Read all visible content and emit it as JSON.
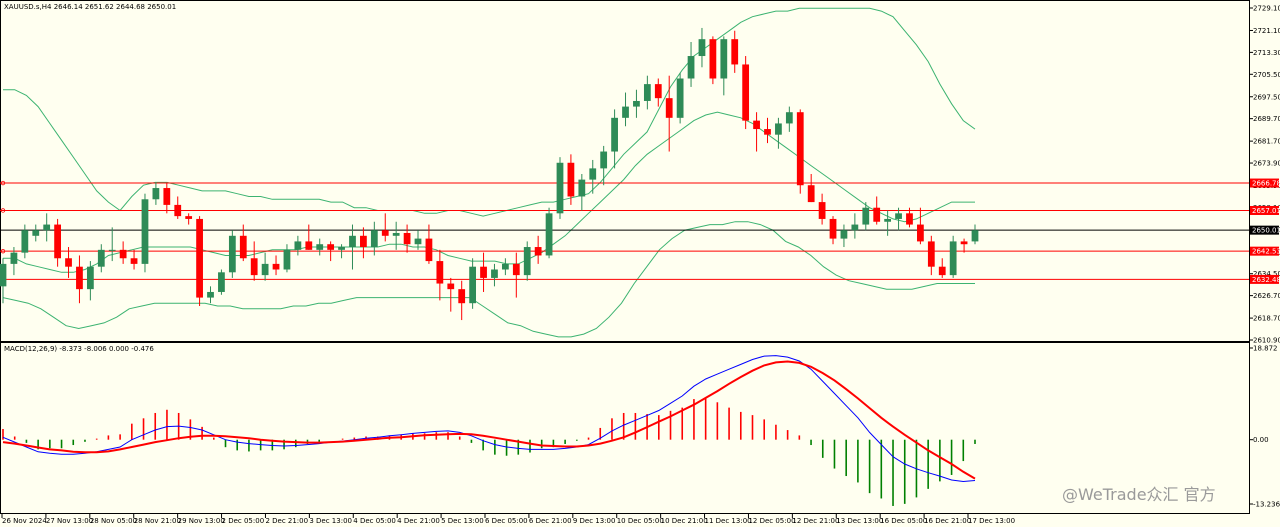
{
  "symbol_header": "XAUUSD.s,H4  2646.14 2651.62 2644.68 2650.01",
  "macd_header": "MACD(12,26,9) -8.373 -8.006 0.000 -0.476",
  "watermark": "@WeTrade众汇 官方",
  "colors": {
    "background": "#fffff0",
    "bull_candle": "#2e8b57",
    "bear_candle": "#ff0000",
    "bollinger": "#3cb371",
    "level_line": "#ff0000",
    "price_line": "#000000",
    "macd_line": "#0000ff",
    "signal_line": "#ff0000",
    "hist_pos": "#ff0000",
    "hist_neg": "#008000"
  },
  "chart_data": [
    {
      "type": "candlestick",
      "title": "XAUUSD.s,H4",
      "y_ticks": [
        "2729.10",
        "2721.10",
        "2713.30",
        "2705.50",
        "2697.50",
        "2689.70",
        "2681.70",
        "2673.90",
        "2665.90",
        "2658.10",
        "2650.30",
        "2642.30",
        "2634.50",
        "2626.70",
        "2618.70",
        "2610.90"
      ],
      "ylim": [
        2610.9,
        2729.1
      ],
      "x_labels": [
        "26 Nov 2024",
        "27 Nov 13:00",
        "28 Nov 05:00",
        "28 Nov 21:00",
        "29 Nov 13:00",
        "2 Dec 05:00",
        "2 Dec 21:00",
        "3 Dec 13:00",
        "4 Dec 05:00",
        "4 Dec 21:00",
        "5 Dec 13:00",
        "6 Dec 05:00",
        "6 Dec 21:00",
        "9 Dec 13:00",
        "10 Dec 05:00",
        "10 Dec 21:00",
        "11 Dec 13:00",
        "12 Dec 05:00",
        "12 Dec 21:00",
        "13 Dec 13:00",
        "16 Dec 05:00",
        "16 Dec 21:00",
        "17 Dec 13:00"
      ],
      "horizontal_levels": [
        {
          "label": "2666.78",
          "value": 2666.78
        },
        {
          "label": "2657.01",
          "value": 2657.01
        },
        {
          "label": "2642.53",
          "value": 2642.53
        },
        {
          "label": "2632.48",
          "value": 2632.48
        }
      ],
      "current_price": {
        "label": "2650.01",
        "value": 2650.01
      },
      "candles": [
        [
          2630,
          2640,
          2624,
          2638
        ],
        [
          2638,
          2644,
          2634,
          2642
        ],
        [
          2642,
          2652,
          2640,
          2650
        ],
        [
          2648,
          2652,
          2646,
          2650
        ],
        [
          2650,
          2656,
          2646,
          2652
        ],
        [
          2652,
          2654,
          2637,
          2640
        ],
        [
          2640,
          2644,
          2633,
          2637
        ],
        [
          2637,
          2641,
          2624,
          2629
        ],
        [
          2629,
          2639,
          2625,
          2637
        ],
        [
          2637,
          2645,
          2635,
          2643
        ],
        [
          2643,
          2651,
          2639,
          2643
        ],
        [
          2643,
          2646,
          2638,
          2640
        ],
        [
          2640,
          2643,
          2636,
          2638
        ],
        [
          2638,
          2663,
          2635,
          2661
        ],
        [
          2661,
          2667,
          2659,
          2665
        ],
        [
          2665,
          2667,
          2656,
          2659
        ],
        [
          2659,
          2662,
          2654,
          2655
        ],
        [
          2655,
          2656,
          2652,
          2654
        ],
        [
          2654,
          2655,
          2623,
          2626
        ],
        [
          2626,
          2630,
          2624,
          2628
        ],
        [
          2628,
          2636,
          2627,
          2635
        ],
        [
          2635,
          2650,
          2633,
          2648
        ],
        [
          2648,
          2652,
          2639,
          2640
        ],
        [
          2640,
          2646,
          2632,
          2634
        ],
        [
          2634,
          2642,
          2632,
          2638
        ],
        [
          2638,
          2641,
          2634,
          2636
        ],
        [
          2636,
          2645,
          2635,
          2643
        ],
        [
          2643,
          2648,
          2641,
          2646
        ],
        [
          2646,
          2652,
          2643,
          2643
        ],
        [
          2643,
          2647,
          2641,
          2645
        ],
        [
          2645,
          2646,
          2639,
          2643
        ],
        [
          2643,
          2645,
          2640,
          2644
        ],
        [
          2644,
          2652,
          2636,
          2648
        ],
        [
          2648,
          2651,
          2640,
          2644
        ],
        [
          2644,
          2653,
          2641,
          2650
        ],
        [
          2650,
          2656,
          2646,
          2648
        ],
        [
          2648,
          2653,
          2643,
          2649
        ],
        [
          2649,
          2652,
          2642,
          2645
        ],
        [
          2645,
          2650,
          2643,
          2647
        ],
        [
          2647,
          2652,
          2638,
          2639
        ],
        [
          2639,
          2643,
          2625,
          2631
        ],
        [
          2631,
          2633,
          2621,
          2629
        ],
        [
          2629,
          2632,
          2618,
          2624
        ],
        [
          2624,
          2640,
          2622,
          2637
        ],
        [
          2637,
          2642,
          2628,
          2633
        ],
        [
          2633,
          2638,
          2630,
          2636
        ],
        [
          2636,
          2640,
          2634,
          2638
        ],
        [
          2638,
          2642,
          2626,
          2634
        ],
        [
          2634,
          2646,
          2632,
          2644
        ],
        [
          2644,
          2648,
          2638,
          2641
        ],
        [
          2641,
          2658,
          2640,
          2656
        ],
        [
          2656,
          2676,
          2654,
          2674
        ],
        [
          2674,
          2677,
          2659,
          2662
        ],
        [
          2662,
          2670,
          2657,
          2668
        ],
        [
          2668,
          2675,
          2663,
          2672
        ],
        [
          2672,
          2680,
          2666,
          2678
        ],
        [
          2678,
          2693,
          2672,
          2690
        ],
        [
          2690,
          2699,
          2687,
          2694
        ],
        [
          2694,
          2700,
          2690,
          2696
        ],
        [
          2696,
          2705,
          2693,
          2702
        ],
        [
          2702,
          2704,
          2694,
          2697
        ],
        [
          2697,
          2705,
          2678,
          2690
        ],
        [
          2690,
          2706,
          2688,
          2704
        ],
        [
          2704,
          2717,
          2701,
          2712
        ],
        [
          2712,
          2722,
          2708,
          2718
        ],
        [
          2718,
          2719,
          2702,
          2704
        ],
        [
          2704,
          2719,
          2698,
          2718
        ],
        [
          2718,
          2721,
          2706,
          2709
        ],
        [
          2709,
          2712,
          2686,
          2689
        ],
        [
          2689,
          2692,
          2678,
          2686
        ],
        [
          2686,
          2690,
          2681,
          2684
        ],
        [
          2684,
          2690,
          2679,
          2688
        ],
        [
          2688,
          2694,
          2685,
          2692
        ],
        [
          2692,
          2693,
          2663,
          2666
        ],
        [
          2666,
          2670,
          2660,
          2660
        ],
        [
          2660,
          2663,
          2652,
          2654
        ],
        [
          2654,
          2655,
          2645,
          2647
        ],
        [
          2647,
          2652,
          2644,
          2650
        ],
        [
          2650,
          2656,
          2647,
          2652
        ],
        [
          2652,
          2660,
          2650,
          2658
        ],
        [
          2658,
          2662,
          2652,
          2653
        ],
        [
          2653,
          2657,
          2648,
          2654
        ],
        [
          2654,
          2658,
          2650,
          2656
        ],
        [
          2656,
          2658,
          2651,
          2652
        ],
        [
          2652,
          2658,
          2645,
          2646
        ],
        [
          2646,
          2648,
          2634,
          2637
        ],
        [
          2637,
          2640,
          2633,
          2634
        ],
        [
          2634,
          2648,
          2633,
          2646
        ],
        [
          2646,
          2647,
          2642,
          2645
        ],
        [
          2646,
          2652,
          2645,
          2650
        ]
      ],
      "bollinger": {
        "upper": [
          2700,
          2700,
          2698,
          2694,
          2688,
          2682,
          2676,
          2670,
          2664,
          2660,
          2657,
          2662,
          2666,
          2667,
          2667,
          2666,
          2665,
          2664,
          2664,
          2664,
          2663,
          2662,
          2662,
          2661,
          2661,
          2661,
          2661,
          2661,
          2660,
          2660,
          2658,
          2658,
          2657,
          2657,
          2657,
          2657,
          2656,
          2656,
          2657,
          2657,
          2656,
          2655,
          2656,
          2657,
          2658,
          2659,
          2660,
          2660,
          2661,
          2662,
          2663,
          2667,
          2672,
          2677,
          2681,
          2685,
          2693,
          2701,
          2707,
          2712,
          2715,
          2718,
          2721,
          2724,
          2726,
          2727,
          2728,
          2728,
          2729,
          2729,
          2729,
          2729,
          2729,
          2729,
          2729,
          2728,
          2726,
          2721,
          2716,
          2710,
          2702,
          2695,
          2689,
          2686
        ],
        "middle": [
          2640,
          2640,
          2638,
          2637,
          2636,
          2635,
          2635,
          2636,
          2638,
          2641,
          2642,
          2643,
          2644,
          2644,
          2644,
          2644,
          2644,
          2643,
          2642,
          2641,
          2641,
          2641,
          2642,
          2643,
          2643,
          2643,
          2644,
          2644,
          2644,
          2644,
          2644,
          2644,
          2644,
          2645,
          2645,
          2644,
          2644,
          2643,
          2641,
          2640,
          2639,
          2639,
          2639,
          2638,
          2638,
          2640,
          2642,
          2645,
          2648,
          2652,
          2656,
          2660,
          2664,
          2668,
          2673,
          2677,
          2680,
          2683,
          2686,
          2689,
          2691,
          2692,
          2691,
          2690,
          2688,
          2685,
          2682,
          2679,
          2676,
          2673,
          2670,
          2667,
          2664,
          2661,
          2658,
          2656,
          2654,
          2653,
          2654,
          2656,
          2658,
          2660,
          2660,
          2660
        ],
        "lower": [
          2626,
          2625,
          2624,
          2622,
          2619,
          2616,
          2615,
          2616,
          2617,
          2619,
          2622,
          2623,
          2624,
          2624,
          2624,
          2624,
          2624,
          2623,
          2623,
          2622,
          2622,
          2622,
          2622,
          2623,
          2623,
          2624,
          2624,
          2625,
          2626,
          2626,
          2626,
          2626,
          2626,
          2626,
          2626,
          2626,
          2626,
          2626,
          2623,
          2620,
          2617,
          2616,
          2614,
          2613,
          2612,
          2612,
          2613,
          2615,
          2619,
          2624,
          2631,
          2637,
          2643,
          2647,
          2650,
          2651,
          2652,
          2652,
          2653,
          2653,
          2652,
          2650,
          2646,
          2644,
          2641,
          2637,
          2634,
          2632,
          2631,
          2630,
          2629,
          2629,
          2629,
          2630,
          2631,
          2631,
          2631,
          2631
        ]
      }
    },
    {
      "type": "macd",
      "title": "MACD(12,26,9)",
      "y_ticks": [
        "18.872",
        "0.00",
        "-13.236"
      ],
      "ylim": [
        -13.236,
        18.872
      ],
      "macd": [
        0.5,
        -0.5,
        -1.5,
        -2.5,
        -2.8,
        -3,
        -3,
        -2.8,
        -2.5,
        -2,
        -1.5,
        0,
        1,
        2,
        2.7,
        2.8,
        2.5,
        2,
        1,
        0,
        -0.5,
        -0.8,
        -1,
        -1.2,
        -1.3,
        -1.2,
        -1,
        -0.8,
        -0.5,
        -0.3,
        0,
        0.3,
        0.5,
        0.8,
        1,
        1.3,
        1.5,
        1.7,
        1.8,
        1.5,
        0.8,
        -0.2,
        -1,
        -1.5,
        -1.8,
        -2,
        -2,
        -2,
        -1.8,
        -1.5,
        -1,
        0.3,
        1.8,
        3,
        4,
        5,
        6,
        7.5,
        9,
        11,
        12.5,
        13.5,
        14.5,
        15.5,
        16.5,
        17.2,
        17.3,
        17,
        16.2,
        14.5,
        12,
        9.5,
        7,
        4.5,
        1.5,
        -1,
        -3.5,
        -5,
        -6,
        -6.8,
        -7.5,
        -8.3,
        -8.6,
        -8.4
      ],
      "signal": [
        -0.5,
        -0.8,
        -1.2,
        -1.6,
        -2,
        -2.2,
        -2.5,
        -2.6,
        -2.6,
        -2.4,
        -2,
        -1.5,
        -1,
        -0.5,
        -0.1,
        0.3,
        0.6,
        0.8,
        0.8,
        0.7,
        0.5,
        0.3,
        0,
        -0.2,
        -0.4,
        -0.5,
        -0.6,
        -0.6,
        -0.5,
        -0.4,
        -0.2,
        0,
        0.2,
        0.4,
        0.5,
        0.7,
        0.9,
        1,
        1.1,
        1.2,
        1.1,
        0.8,
        0.4,
        0,
        -0.4,
        -0.8,
        -1.2,
        -1.3,
        -1.4,
        -1.4,
        -1.2,
        -0.8,
        -0.2,
        0.5,
        1.5,
        2.6,
        3.7,
        4.8,
        6,
        7.2,
        8.6,
        10,
        11.5,
        12.9,
        14.2,
        15.3,
        15.9,
        16.1,
        15.8,
        15,
        13.7,
        12.2,
        10.4,
        8.5,
        6.5,
        4.5,
        2.7,
        1,
        -0.6,
        -2.2,
        -3.6,
        -5,
        -6.6,
        -8
      ],
      "histogram": [
        1,
        0.3,
        -0.3,
        -0.9,
        -0.8,
        -0.8,
        -0.5,
        -0.2,
        0.1,
        0.4,
        0.5,
        1.5,
        2,
        2.5,
        2.8,
        2.5,
        1.9,
        1.2,
        0.2,
        -0.7,
        -1,
        -1.1,
        -1,
        -1,
        -0.9,
        -0.7,
        -0.4,
        -0.2,
        0,
        0.1,
        0.2,
        0.3,
        0.3,
        0.4,
        0.5,
        0.6,
        0.6,
        0.7,
        0.7,
        0.3,
        -0.3,
        -1,
        -1.4,
        -1.5,
        -1.4,
        -1.2,
        -0.8,
        -0.7,
        -0.4,
        -0.1,
        0.2,
        1.1,
        2,
        2.5,
        2.5,
        2.4,
        2.3,
        2.7,
        3,
        3.8,
        3.9,
        3.5,
        3,
        2.6,
        2.3,
        1.9,
        1.4,
        0.9,
        0.4,
        -0.5,
        -1.7,
        -2.7,
        -3.4,
        -4,
        -5,
        -5.5,
        -6.2,
        -6,
        -5.4,
        -4.6,
        -3.9,
        -3.3,
        -2,
        -0.4
      ]
    }
  ]
}
